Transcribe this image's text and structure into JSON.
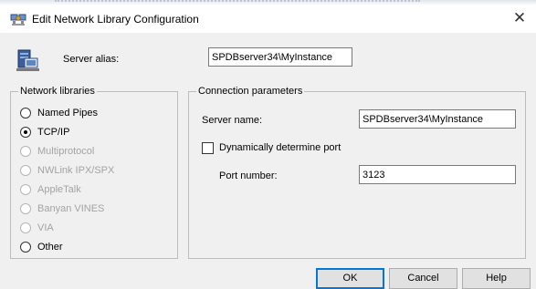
{
  "window": {
    "title": "Edit Network Library Configuration",
    "icon": "network-config-icon",
    "close_glyph": "✕"
  },
  "alias": {
    "label": "Server alias:",
    "value": "SPDBserver34\\MyInstance",
    "icon": "computer-network-icon"
  },
  "network_libraries": {
    "legend": "Network libraries",
    "options": [
      {
        "label": "Named Pipes",
        "selected": false,
        "enabled": true
      },
      {
        "label": "TCP/IP",
        "selected": true,
        "enabled": true
      },
      {
        "label": "Multiprotocol",
        "selected": false,
        "enabled": false
      },
      {
        "label": "NWLink IPX/SPX",
        "selected": false,
        "enabled": false
      },
      {
        "label": "AppleTalk",
        "selected": false,
        "enabled": false
      },
      {
        "label": "Banyan VINES",
        "selected": false,
        "enabled": false
      },
      {
        "label": "VIA",
        "selected": false,
        "enabled": false
      },
      {
        "label": "Other",
        "selected": false,
        "enabled": true
      }
    ]
  },
  "connection": {
    "legend": "Connection parameters",
    "server_name_label": "Server name:",
    "server_name_value": "SPDBserver34\\MyInstance",
    "dynamic_port_label": "Dynamically determine port",
    "dynamic_port_checked": false,
    "port_label": "Port number:",
    "port_value": "3123"
  },
  "buttons": {
    "ok": "OK",
    "cancel": "Cancel",
    "help": "Help"
  }
}
